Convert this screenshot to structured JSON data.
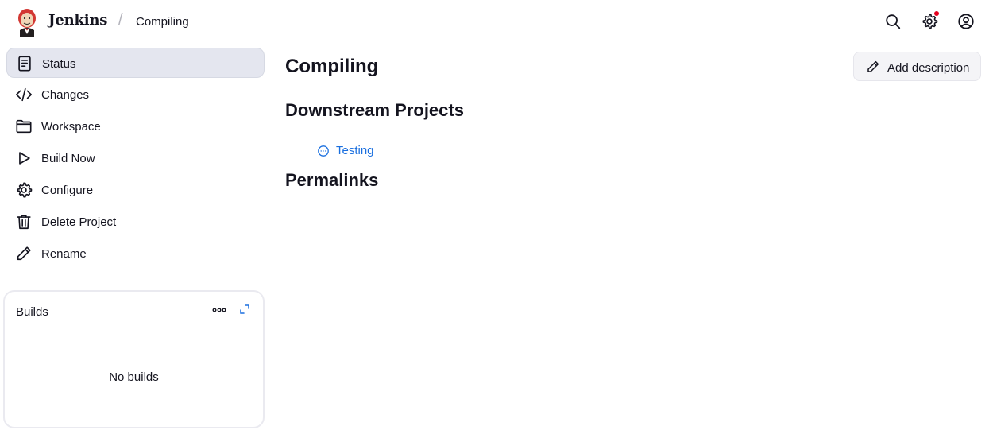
{
  "header": {
    "brand": "Jenkins",
    "breadcrumb_separator": "/",
    "breadcrumb": "Compiling",
    "icons": [
      "search-icon",
      "gear-icon",
      "user-icon"
    ],
    "notification_color": "#e6001f"
  },
  "sidebar": {
    "items": [
      {
        "label": "Status",
        "icon": "document-icon",
        "active": true
      },
      {
        "label": "Changes",
        "icon": "code-icon"
      },
      {
        "label": "Workspace",
        "icon": "folder-icon"
      },
      {
        "label": "Build Now",
        "icon": "play-icon"
      },
      {
        "label": "Configure",
        "icon": "gear-icon"
      },
      {
        "label": "Delete Project",
        "icon": "trash-icon"
      },
      {
        "label": "Rename",
        "icon": "pencil-icon"
      }
    ]
  },
  "builds": {
    "title": "Builds",
    "empty_text": "No builds"
  },
  "main": {
    "title": "Compiling",
    "add_description_label": "Add description",
    "downstream_heading": "Downstream Projects",
    "downstream_items": [
      {
        "label": "Testing",
        "icon": "not-built-status-icon"
      }
    ],
    "permalinks_heading": "Permalinks",
    "link_color": "#1a6fdf"
  }
}
